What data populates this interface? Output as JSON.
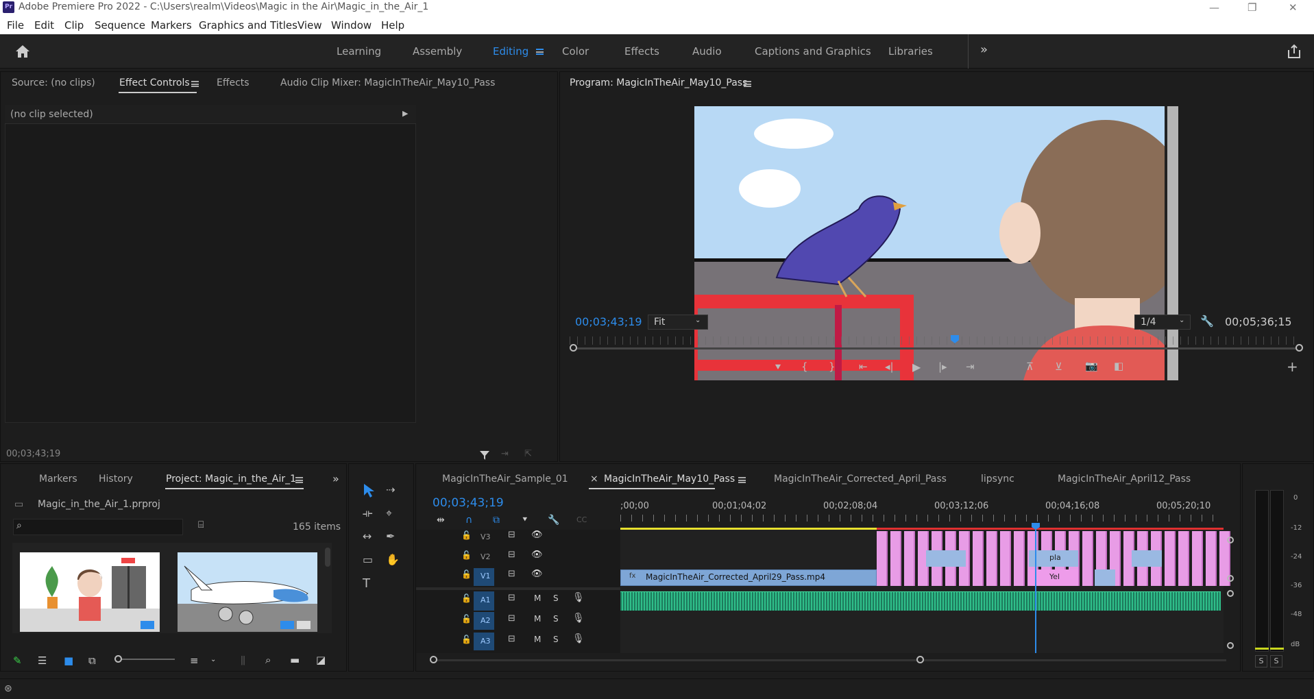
{
  "app": {
    "title": "Adobe Premiere Pro 2022 - C:\\Users\\realm\\Videos\\Magic in the Air\\Magic_in_the_Air_1",
    "logo": "Pr"
  },
  "menu": [
    "File",
    "Edit",
    "Clip",
    "Sequence",
    "Markers",
    "Graphics and Titles",
    "View",
    "Window",
    "Help"
  ],
  "workspaces": [
    "Learning",
    "Assembly",
    "Editing",
    "Color",
    "Effects",
    "Audio",
    "Captions and Graphics",
    "Libraries"
  ],
  "active_workspace": "Editing",
  "source_panel": {
    "tabs": [
      "Source: (no clips)",
      "Effect Controls",
      "Effects",
      "Audio Clip Mixer: MagicInTheAir_May10_Pass"
    ],
    "no_clip": "(no clip selected)",
    "timecode": "00;03;43;19"
  },
  "program": {
    "title": "Program: MagicInTheAir_May10_Pass",
    "timecode": "00;03;43;19",
    "zoom": "Fit",
    "resolution": "1/4",
    "duration": "00;05;36;15"
  },
  "project": {
    "tabs": [
      "Markers",
      "History",
      "Project: Magic_in_the_Air_1"
    ],
    "file": "Magic_in_the_Air_1.prproj",
    "count": "165 items"
  },
  "timeline": {
    "tabs": [
      "MagicInTheAir_Sample_01",
      "MagicInTheAir_May10_Pass",
      "MagicInTheAir_Corrected_April_Pass",
      "lipsync",
      "MagicInTheAir_April12_Pass"
    ],
    "timecode": "00;03;43;19",
    "ruler": [
      ";00;00",
      "00;01;04;02",
      "00;02;08;04",
      "00;03;12;06",
      "00;04;16;08",
      "00;05;20;10"
    ],
    "video_tracks": [
      "V3",
      "V2",
      "V1"
    ],
    "audio_tracks": [
      "A1",
      "A2",
      "A3"
    ],
    "clip_v1": "MagicInTheAir_Corrected_April29_Pass.mp4",
    "clip_pla": "pla",
    "clip_yel": "Yel",
    "m": "M",
    "s": "S"
  },
  "meter": {
    "labels": [
      "0",
      "-12",
      "-24",
      "-36",
      "-48",
      "dB"
    ],
    "solo": "S"
  }
}
